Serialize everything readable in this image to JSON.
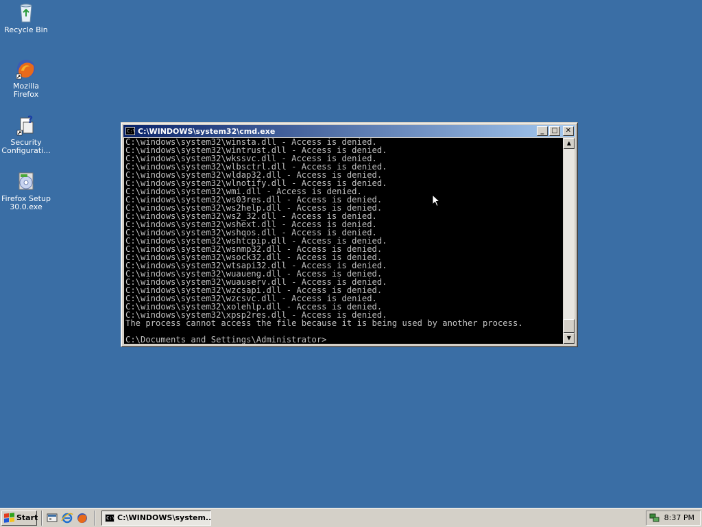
{
  "desktop": {
    "icons": [
      {
        "label": "Recycle Bin",
        "icon": "recycle-bin-icon"
      },
      {
        "label": "Mozilla Firefox",
        "icon": "firefox-icon"
      },
      {
        "label": "Security Configurati...",
        "icon": "security-config-icon"
      },
      {
        "label": "Firefox Setup 30.0.exe",
        "icon": "setup-installer-icon"
      }
    ]
  },
  "cmd_window": {
    "title": "C:\\WINDOWS\\system32\\cmd.exe",
    "icon_text": "C:\\",
    "controls": {
      "minimize": "_",
      "maximize": "□",
      "close": "✕"
    },
    "lines": [
      "C:\\windows\\system32\\winsta.dll - Access is denied.",
      "C:\\windows\\system32\\wintrust.dll - Access is denied.",
      "C:\\windows\\system32\\wkssvc.dll - Access is denied.",
      "C:\\windows\\system32\\wlbsctrl.dll - Access is denied.",
      "C:\\windows\\system32\\wldap32.dll - Access is denied.",
      "C:\\windows\\system32\\wlnotify.dll - Access is denied.",
      "C:\\windows\\system32\\wmi.dll - Access is denied.",
      "C:\\windows\\system32\\ws03res.dll - Access is denied.",
      "C:\\windows\\system32\\ws2help.dll - Access is denied.",
      "C:\\windows\\system32\\ws2_32.dll - Access is denied.",
      "C:\\windows\\system32\\wshext.dll - Access is denied.",
      "C:\\windows\\system32\\wshqos.dll - Access is denied.",
      "C:\\windows\\system32\\wshtcpip.dll - Access is denied.",
      "C:\\windows\\system32\\wsnmp32.dll - Access is denied.",
      "C:\\windows\\system32\\wsock32.dll - Access is denied.",
      "C:\\windows\\system32\\wtsapi32.dll - Access is denied.",
      "C:\\windows\\system32\\wuaueng.dll - Access is denied.",
      "C:\\windows\\system32\\wuauserv.dll - Access is denied.",
      "C:\\windows\\system32\\wzcsapi.dll - Access is denied.",
      "C:\\windows\\system32\\wzcsvc.dll - Access is denied.",
      "C:\\windows\\system32\\xolehlp.dll - Access is denied.",
      "C:\\windows\\system32\\xpsp2res.dll - Access is denied.",
      "The process cannot access the file because it is being used by another process.",
      "",
      "C:\\Documents and Settings\\Administrator>"
    ]
  },
  "taskbar": {
    "start_label": "Start",
    "quick_launch": [
      "show-desktop-icon",
      "internet-explorer-icon",
      "firefox-icon"
    ],
    "task_button_label": "C:\\WINDOWS\\system...",
    "clock": "8:37 PM",
    "tray_icons": [
      "network-tray-icon"
    ]
  },
  "colors": {
    "desktop": "#3a6ea5",
    "titlebar_start": "#0a246a",
    "titlebar_end": "#a6caf0",
    "console_bg": "#000000",
    "console_text": "#c0c0c0"
  }
}
